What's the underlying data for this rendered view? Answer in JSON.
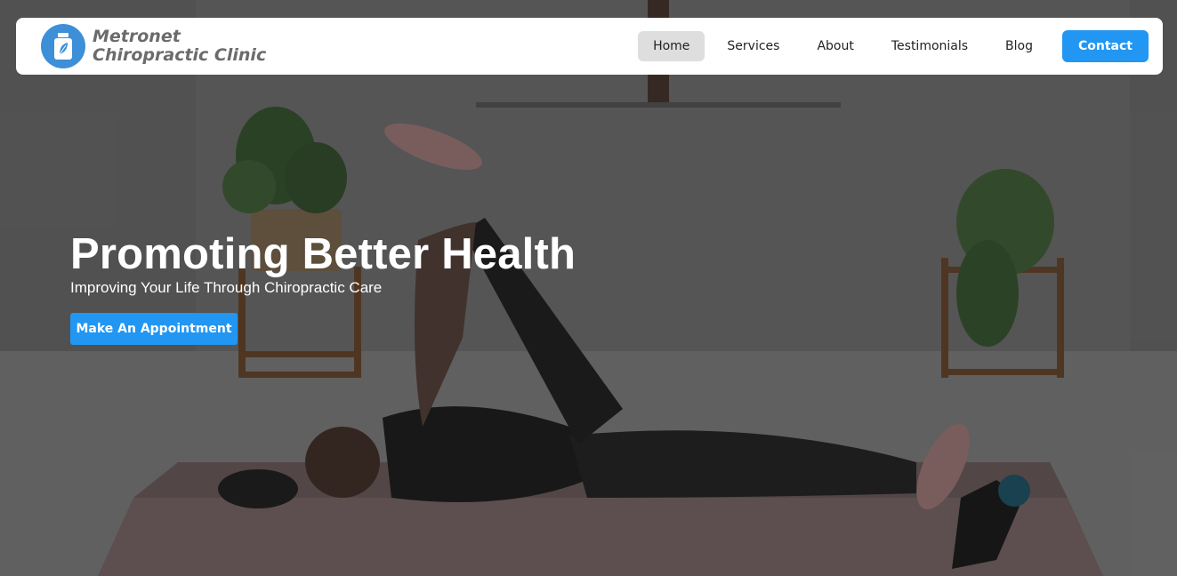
{
  "brand": {
    "name": "Metronet Chiropractic Clinic",
    "logo_icon": "bottle-leaf-icon",
    "logo_color": "#3d8fd8"
  },
  "nav": {
    "items": [
      {
        "label": "Home",
        "active": true
      },
      {
        "label": "Services",
        "active": false
      },
      {
        "label": "About",
        "active": false
      },
      {
        "label": "Testimonials",
        "active": false
      },
      {
        "label": "Blog",
        "active": false
      }
    ],
    "contact_label": "Contact",
    "accent": "#2196f3"
  },
  "hero": {
    "title": "Promoting Better Health",
    "subtitle": "Improving Your Life Through Chiropractic Care",
    "cta_label": "Make An Appointment",
    "background_image": "woman-stretching-on-rug"
  }
}
